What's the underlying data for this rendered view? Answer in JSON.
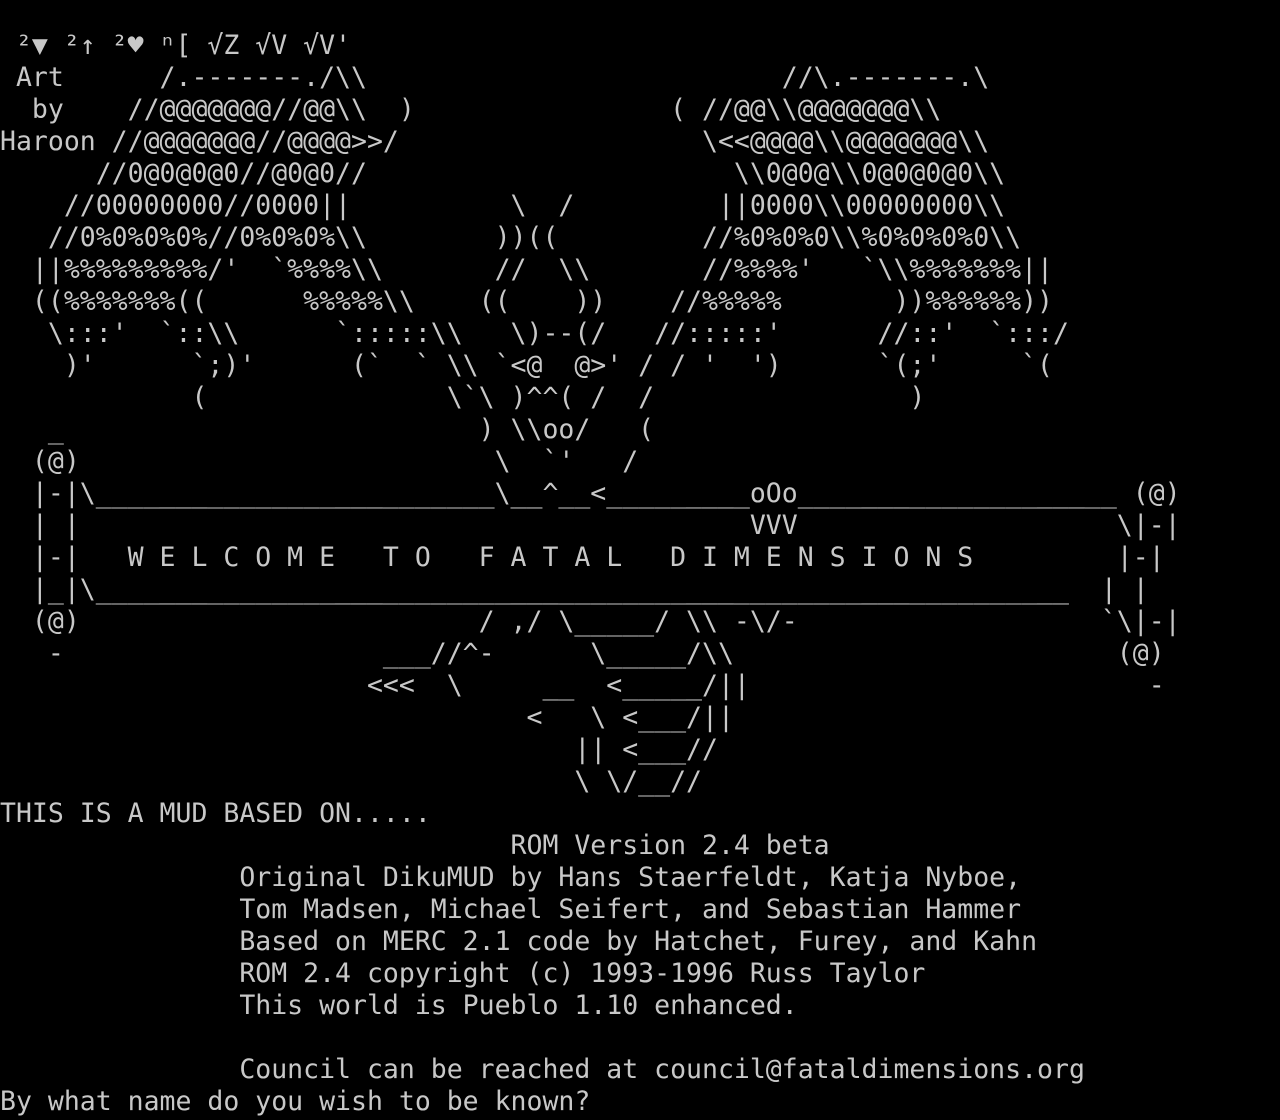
{
  "terminal": {
    "background": "#000000",
    "foreground": "#c8c8c8",
    "lines": [
      " ²▼ ²↑ ²♥ ⁿ[ √Z √V √V'",
      " Art      /.-------./\\\\                          //\\.-------.\\",
      "  by    //@@@@@@@//@@\\\\  )                ( //@@\\\\@@@@@@@\\\\",
      "Haroon //@@@@@@@//@@@@>>/                   \\<<@@@@\\\\@@@@@@@\\\\",
      "      //0@0@0@0//@0@0//                       \\\\0@0@\\\\0@0@0@0\\\\",
      "    //00000000//0000||          \\  /         ||0000\\\\00000000\\\\",
      "   //0%0%0%0%//0%0%0%\\\\        ))((         //%0%0%0\\\\%0%0%0%0\\\\",
      "  ||%%%%%%%%%/'  `%%%%\\\\       //  \\\\       //%%%%'   `\\\\%%%%%%%||",
      "  ((%%%%%%%((      %%%%%\\\\    ((    ))    //%%%%%       ))%%%%%%))",
      "   \\:::'  `::\\\\      `:::::\\\\   \\)--(/   //:::::'      //::'  `:::/",
      "    )'      `;)'      (`  ` \\\\ `<@  @>' / / '  ')      `(;'     `(",
      "            (               \\`\\ )^^( /  /                )",
      "   _                          ) \\\\oo/   (",
      "  (@)                          \\  `'   /",
      "  |-|\\_________________________\\__^__<_________oOo____________________ (@)",
      "  | |                                          VVV                    \\|-|",
      "  |-|   W E L C O M E   T O   F A T A L   D I M E N S I O N S         |-|",
      "  |_|\\_____________________________________________________________  | |",
      "  (@)                         / ,/ \\_____/ \\\\ -\\/-                   `\\|-|",
      "   -                    ___//^-      \\_____/\\\\                        (@)",
      "                       <<<  \\     __  <_____/||                         -",
      "                                 <   \\ <___/||",
      "                                    || <___//",
      "                                    \\ \\/__//",
      "THIS IS A MUD BASED ON.....",
      "                                ROM Version 2.4 beta",
      "               Original DikuMUD by Hans Staerfeldt, Katja Nyboe,",
      "               Tom Madsen, Michael Seifert, and Sebastian Hammer",
      "               Based on MERC 2.1 code by Hatchet, Furey, and Kahn",
      "               ROM 2.4 copyright (c) 1993-1996 Russ Taylor",
      "               This world is Pueblo 1.10 enhanced.",
      "",
      "               Council can be reached at council@fataldimensions.org"
    ],
    "prompt": "By what name do you wish to be known?"
  }
}
